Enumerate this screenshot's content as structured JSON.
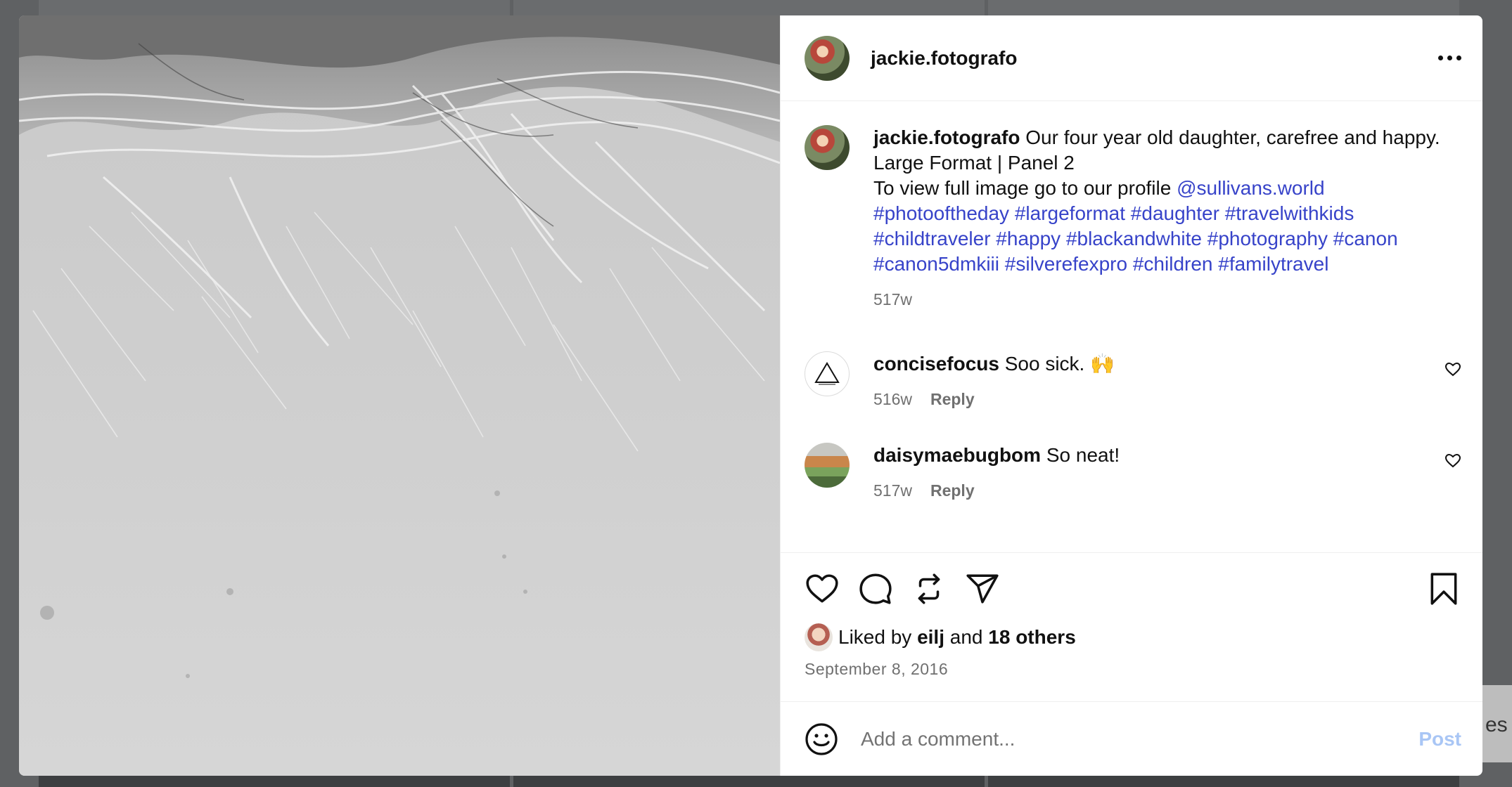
{
  "backdrop": {
    "peek_text": "es"
  },
  "post": {
    "author": "jackie.fotografo",
    "caption": {
      "user": "jackie.fotografo",
      "line1": "Our four year old daughter, carefree and happy.",
      "line2": "Large Format | Panel 2",
      "line3_text": "To view full image go to our profile",
      "mention": "@sullivans.world",
      "hashtags_line1": "#photooftheday #largeformat #daughter #travelwithkids",
      "hashtags_line2": "#childtraveler #happy #blackandwhite #photography #canon",
      "hashtags_line3": "#canon5dmkiii #silverefexpro #children #familytravel",
      "age": "517w"
    },
    "comments": [
      {
        "user": "concisefocus",
        "text": "Soo sick. 🙌",
        "age": "516w",
        "reply_label": "Reply"
      },
      {
        "user": "daisymaebugbom",
        "text": "So neat!",
        "age": "517w",
        "reply_label": "Reply"
      }
    ],
    "likes": {
      "prefix": "Liked by",
      "user": "eilj",
      "joiner": "and",
      "others": "18 others"
    },
    "date": "September 8, 2016",
    "add_comment": {
      "placeholder": "Add a comment...",
      "post_label": "Post"
    }
  },
  "colors": {
    "link": "#3743c9",
    "post_disabled": "#a9c6f5",
    "muted": "#707070"
  },
  "icons": [
    "more-icon",
    "heart-icon",
    "comment-icon",
    "repost-icon",
    "share-icon",
    "bookmark-icon",
    "smile-icon"
  ]
}
